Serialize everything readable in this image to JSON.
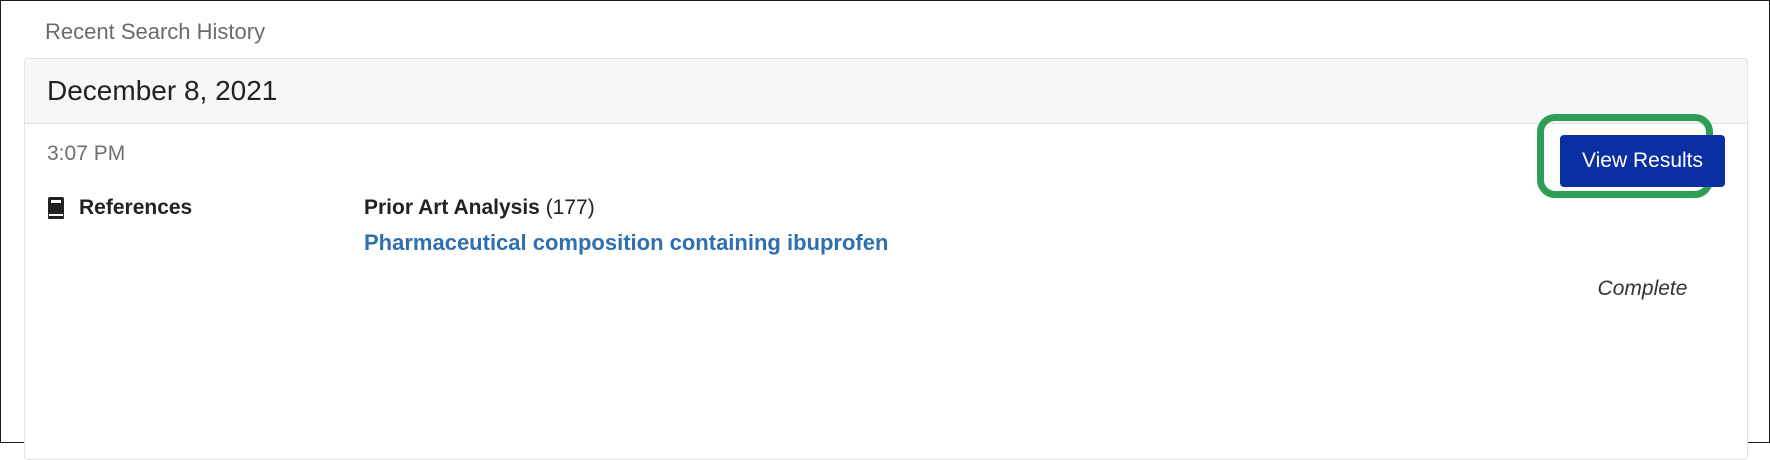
{
  "history": {
    "heading": "Recent Search History",
    "groups": [
      {
        "date": "December 8, 2021",
        "entries": [
          {
            "time": "3:07 PM",
            "type_icon": "book-icon",
            "type_label": "References",
            "analysis_name": "Prior Art Analysis",
            "analysis_count": "(177)",
            "query_link": "Pharmaceutical composition containing ibuprofen",
            "action_label": "View Results",
            "status": "Complete"
          }
        ]
      }
    ]
  },
  "colors": {
    "button_bg": "#0a2fa3",
    "link": "#2f6fad",
    "highlight": "#2e9e57"
  }
}
